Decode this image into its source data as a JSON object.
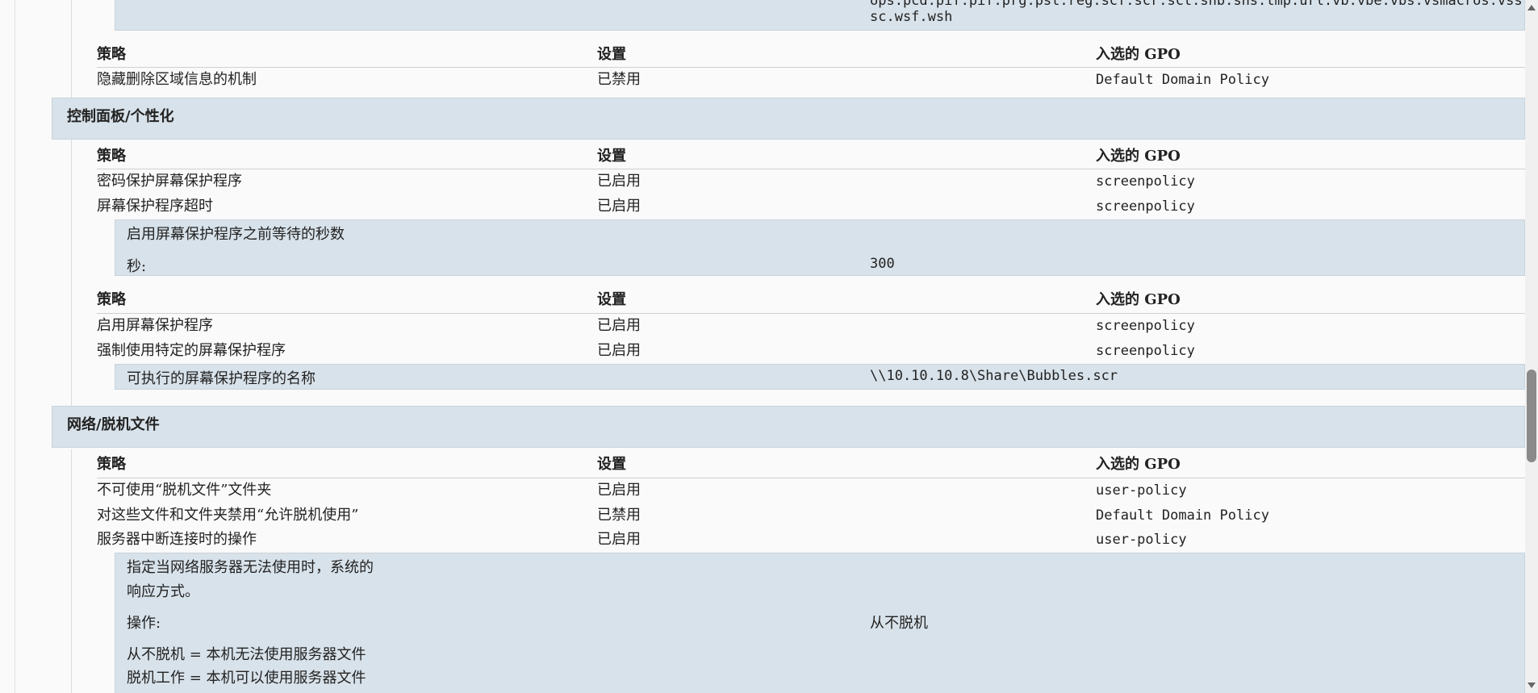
{
  "top_detail": {
    "line1": "ops.pcd.pif.pif.prg.pst.reg.scf.scr.sct.shb.shs.tmp.url.vb.vbe.vbs.vsmacros.vss.vst.v",
    "line2": "sc.wsf.wsh"
  },
  "headers": {
    "policy": "策略",
    "setting": "设置",
    "gpo": "入选的 GPO"
  },
  "block1": {
    "rows": [
      {
        "policy": "隐藏删除区域信息的机制",
        "setting": "已禁用",
        "gpo": "Default Domain Policy"
      }
    ]
  },
  "sections": {
    "control_panel": "控制面板/个性化",
    "network_offline": "网络/脱机文件"
  },
  "cp_table1": {
    "rows": [
      {
        "policy": "密码保护屏幕保护程序",
        "setting": "已启用",
        "gpo": "screenpolicy"
      },
      {
        "policy": "屏幕保护程序超时",
        "setting": "已启用",
        "gpo": "screenpolicy"
      }
    ],
    "detail": {
      "title": "启用屏幕保护程序之前等待的秒数",
      "label": "秒:",
      "value": "300"
    }
  },
  "cp_table2": {
    "rows": [
      {
        "policy": "启用屏幕保护程序",
        "setting": "已启用",
        "gpo": "screenpolicy"
      },
      {
        "policy": "强制使用特定的屏幕保护程序",
        "setting": "已启用",
        "gpo": "screenpolicy"
      }
    ],
    "detail": {
      "label": "可执行的屏幕保护程序的名称",
      "value": "\\\\10.10.10.8\\Share\\Bubbles.scr"
    }
  },
  "net_table": {
    "rows": [
      {
        "policy": "不可使用“脱机文件”文件夹",
        "setting": "已启用",
        "gpo": "user-policy"
      },
      {
        "policy": "对这些文件和文件夹禁用“允许脱机使用”",
        "setting": "已禁用",
        "gpo": "Default Domain Policy"
      },
      {
        "policy": "服务器中断连接时的操作",
        "setting": "已启用",
        "gpo": "user-policy"
      }
    ],
    "detail": {
      "desc1": "指定当网络服务器无法使用时，系统的",
      "desc2": "响应方式。",
      "label": "操作:",
      "value": "从不脱机",
      "note1": "从不脱机 = 本机无法使用服务器文件",
      "note2": "脱机工作 = 本机可以使用服务器文件"
    }
  }
}
